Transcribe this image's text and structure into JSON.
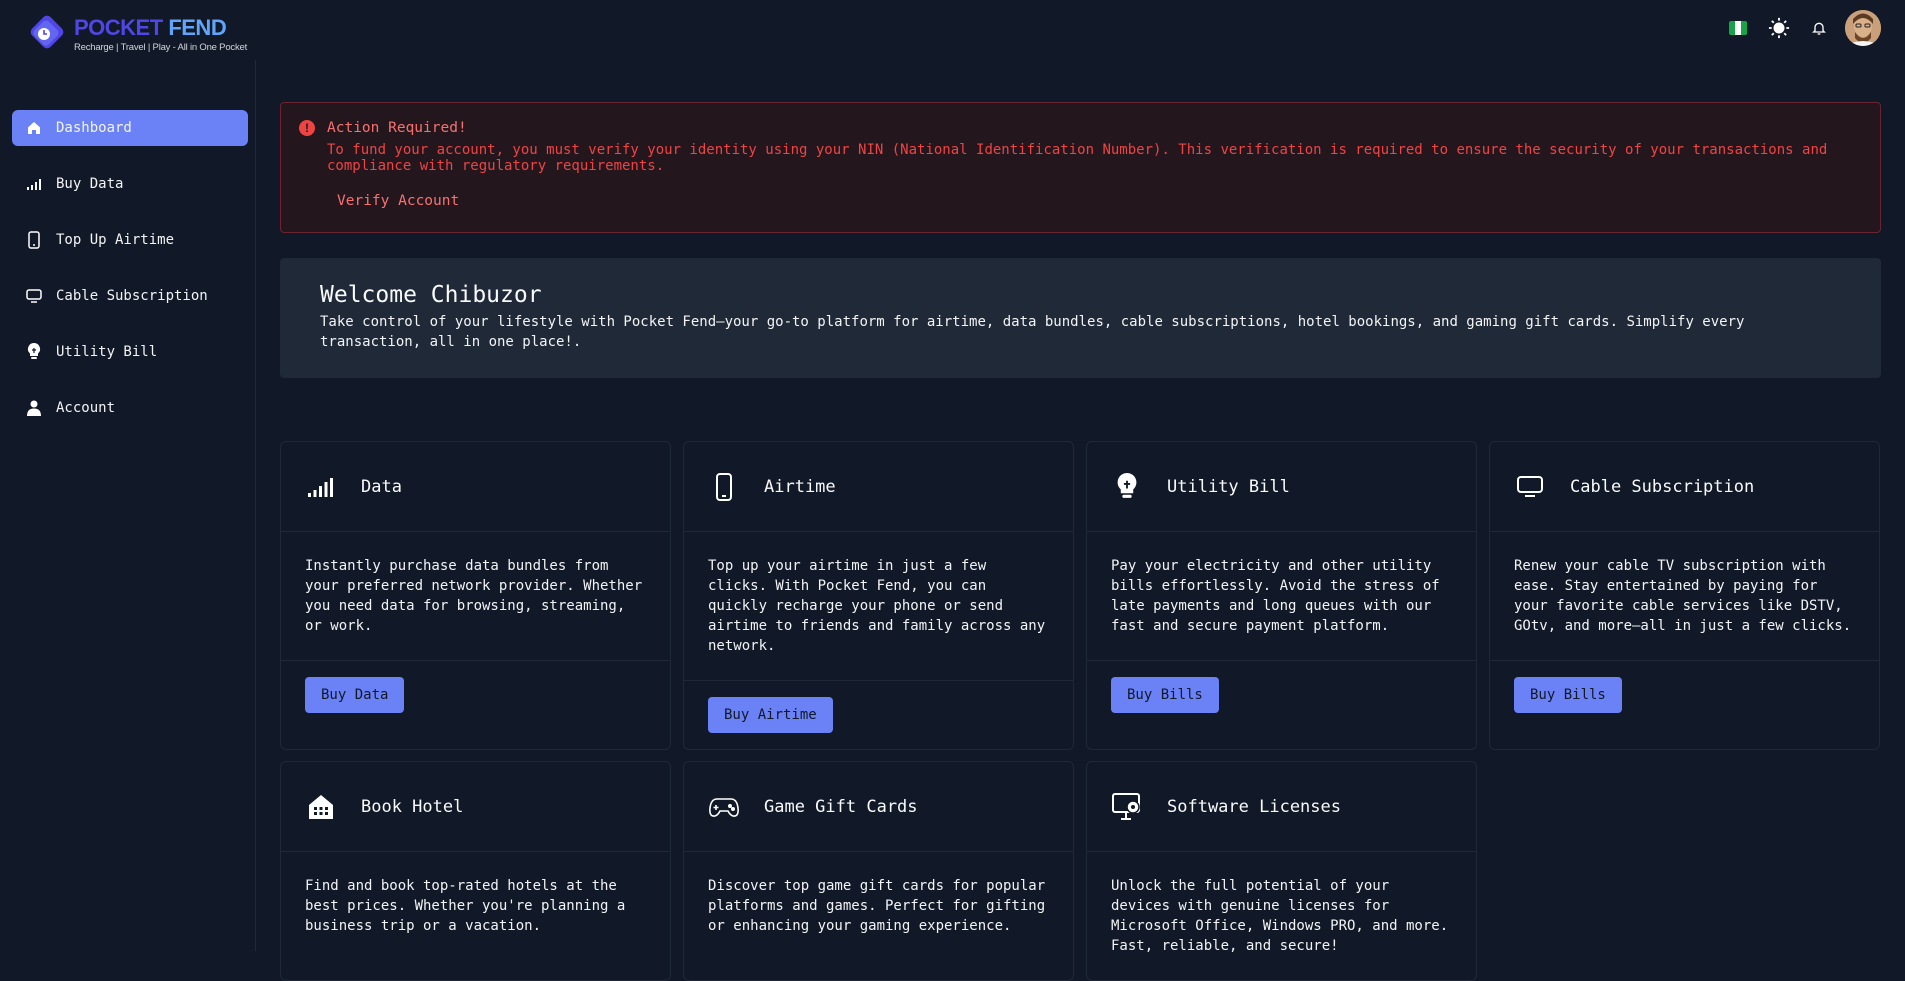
{
  "brand": {
    "name_part1": "POCKET",
    "name_part2": "FEND",
    "tagline": "Recharge | Travel | Play - All in One Pocket"
  },
  "header": {
    "flag_colors": [
      "#16a34a",
      "#ffffff",
      "#16a34a"
    ],
    "icons": [
      "nigeria-flag-icon",
      "sun-icon",
      "bell-icon",
      "user-avatar"
    ]
  },
  "sidebar": {
    "items": [
      {
        "label": "Dashboard",
        "icon": "home-icon",
        "active": true
      },
      {
        "label": "Buy Data",
        "icon": "signal-icon"
      },
      {
        "label": "Top Up Airtime",
        "icon": "phone-icon"
      },
      {
        "label": "Cable Subscription",
        "icon": "tv-icon"
      },
      {
        "label": "Utility Bill",
        "icon": "lightbulb-icon"
      },
      {
        "label": "Account",
        "icon": "user-icon"
      }
    ]
  },
  "alert": {
    "title": "Action Required!",
    "message": "To fund your account, you must verify your identity using your NIN (National Identification Number). This verification is required to ensure the security of your transactions and compliance with regulatory requirements.",
    "link": "Verify Account"
  },
  "welcome": {
    "title": "Welcome Chibuzor",
    "text": "Take control of your lifestyle with Pocket Fend—your go-to platform for airtime, data bundles, cable subscriptions, hotel bookings, and gaming gift cards. Simplify every transaction, all in one place!."
  },
  "cards": [
    {
      "title": "Data",
      "icon": "signal-icon",
      "text": "Instantly purchase data bundles from your preferred network provider. Whether you need data for browsing, streaming, or work.",
      "button": "Buy Data"
    },
    {
      "title": "Airtime",
      "icon": "phone-icon",
      "text": "Top up your airtime in just a few clicks. With Pocket Fend, you can quickly recharge your phone or send airtime to friends and family across any network.",
      "button": "Buy Airtime"
    },
    {
      "title": "Utility Bill",
      "icon": "lightbulb-icon",
      "text": "Pay your electricity and other utility bills effortlessly. Avoid the stress of late payments and long queues with our fast and secure payment platform.",
      "button": "Buy Bills"
    },
    {
      "title": "Cable Subscription",
      "icon": "tv-icon",
      "text": "Renew your cable TV subscription with ease. Stay entertained by paying for your favorite cable services like DSTV, GOtv, and more—all in just a few clicks.",
      "button": "Buy Bills"
    },
    {
      "title": "Book Hotel",
      "icon": "hotel-icon",
      "text": "Find and book top-rated hotels at the best prices. Whether you're planning a business trip or a vacation."
    },
    {
      "title": "Game Gift Cards",
      "icon": "gamepad-icon",
      "text": "Discover top game gift cards for popular platforms and games. Perfect for gifting or enhancing your gaming experience."
    },
    {
      "title": "Software Licenses",
      "icon": "software-icon",
      "text": "Unlock the full potential of your devices with genuine licenses for Microsoft Office, Windows PRO, and more. Fast, reliable, and secure!"
    }
  ],
  "colors": {
    "background": "#111827",
    "accent": "#6b82f7",
    "alert_text": "#ef4444",
    "welcome_bg": "#1f2937"
  }
}
